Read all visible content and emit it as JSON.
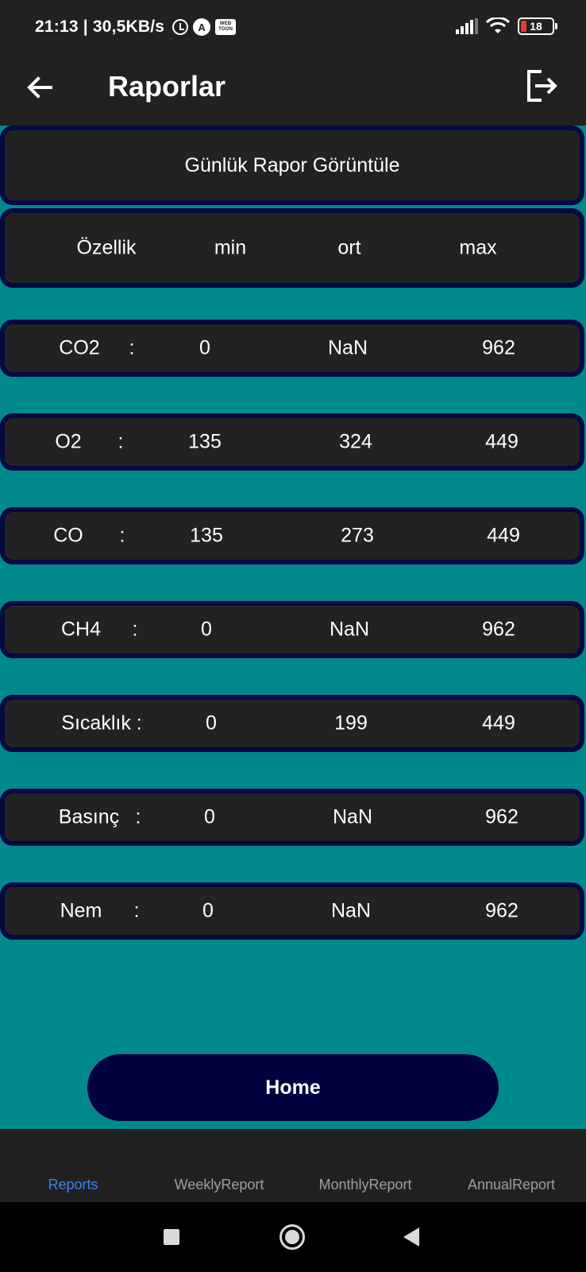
{
  "status_bar": {
    "time_speed": "21:13 | 30,5KB/s",
    "app_icon": "A",
    "webtoon_icon": "WEB TOON",
    "battery": "18"
  },
  "app_bar": {
    "title": "Raporlar",
    "back_icon": "arrow-left-icon",
    "logout_icon": "logout-icon"
  },
  "report": {
    "title": "Günlük Rapor Görüntüle",
    "headers": [
      "Özellik",
      "min",
      "ort",
      "max"
    ],
    "rows": [
      {
        "name": "CO2",
        "sep": ":",
        "min": "0",
        "avg": "NaN",
        "max": "962"
      },
      {
        "name": "O2",
        "sep": ":",
        "min": "135",
        "avg": "324",
        "max": "449"
      },
      {
        "name": "CO",
        "sep": ":",
        "min": "135",
        "avg": "273",
        "max": "449"
      },
      {
        "name": "CH4",
        "sep": ":",
        "min": "0",
        "avg": "NaN",
        "max": "962"
      },
      {
        "name": "Sıcaklık :",
        "sep": "",
        "min": "0",
        "avg": "199",
        "max": "449"
      },
      {
        "name": "Basınç",
        "sep": ":",
        "min": "0",
        "avg": "NaN",
        "max": "962"
      },
      {
        "name": "Nem",
        "sep": ":",
        "min": "0",
        "avg": "NaN",
        "max": "962"
      }
    ]
  },
  "home_button": "Home",
  "tabs": [
    "Reports",
    "WeeklyReport",
    "MonthlyReport",
    "AnnualReport"
  ],
  "colors": {
    "background": "#00898c",
    "card": "#222222",
    "card_border": "#040942",
    "home_button": "#010140",
    "active_tab": "#3b82f6"
  }
}
